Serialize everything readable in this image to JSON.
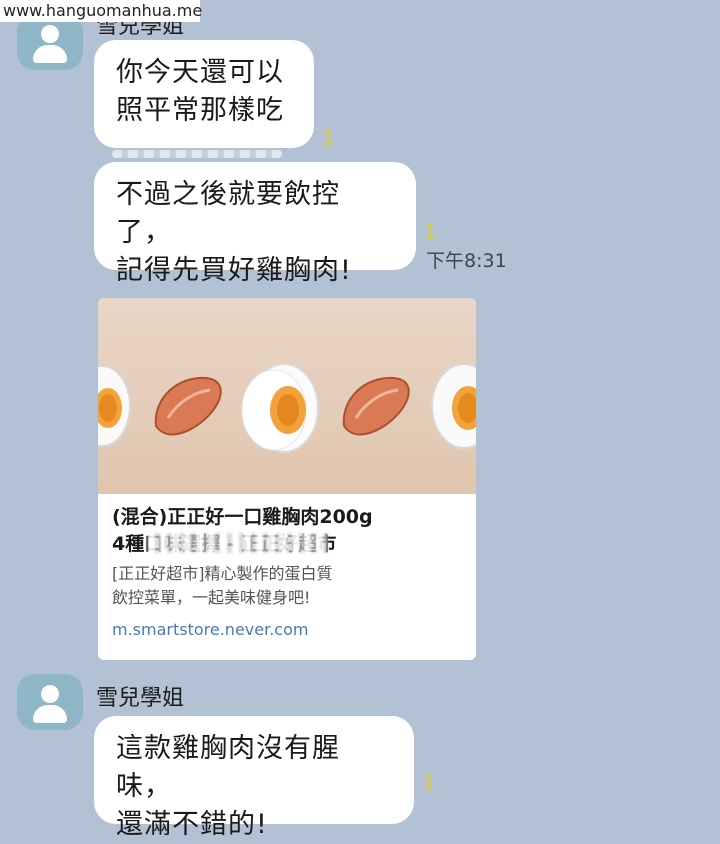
{
  "watermark": "www.hanguomanhua.me",
  "messages": [
    {
      "sender": "雪兒學姐",
      "text": "你今天還可以\n照平常那樣吃",
      "unread": "1"
    },
    {
      "text": "不過之後就要飲控了，\n記得先買好雞胸肉!",
      "unread": "1",
      "time": "下午8:31"
    },
    {
      "link": {
        "title": "(混合)正正好一口雞胸肉200g\n4種口味選擇 - 正正好超市",
        "description": "[正正好超市]精心製作的蛋白質\n飲控菜單，一起美味健身吧!",
        "url": "m.smartstore.never.com"
      }
    },
    {
      "sender": "雪兒學姐",
      "text": "這款雞胸肉沒有腥味，\n還滿不錯的!",
      "unread": "1"
    }
  ],
  "colors": {
    "background": "#b2c1d3",
    "bubble": "#ffffff",
    "avatar": "#8fb6c6",
    "unread": "#e2cb2a",
    "link": "#4a79b8"
  },
  "icons": {
    "avatar": "person-icon",
    "preview_items": [
      "egg-icon",
      "chicken-breast-icon",
      "egg-icon",
      "chicken-breast-icon",
      "egg-icon"
    ]
  }
}
